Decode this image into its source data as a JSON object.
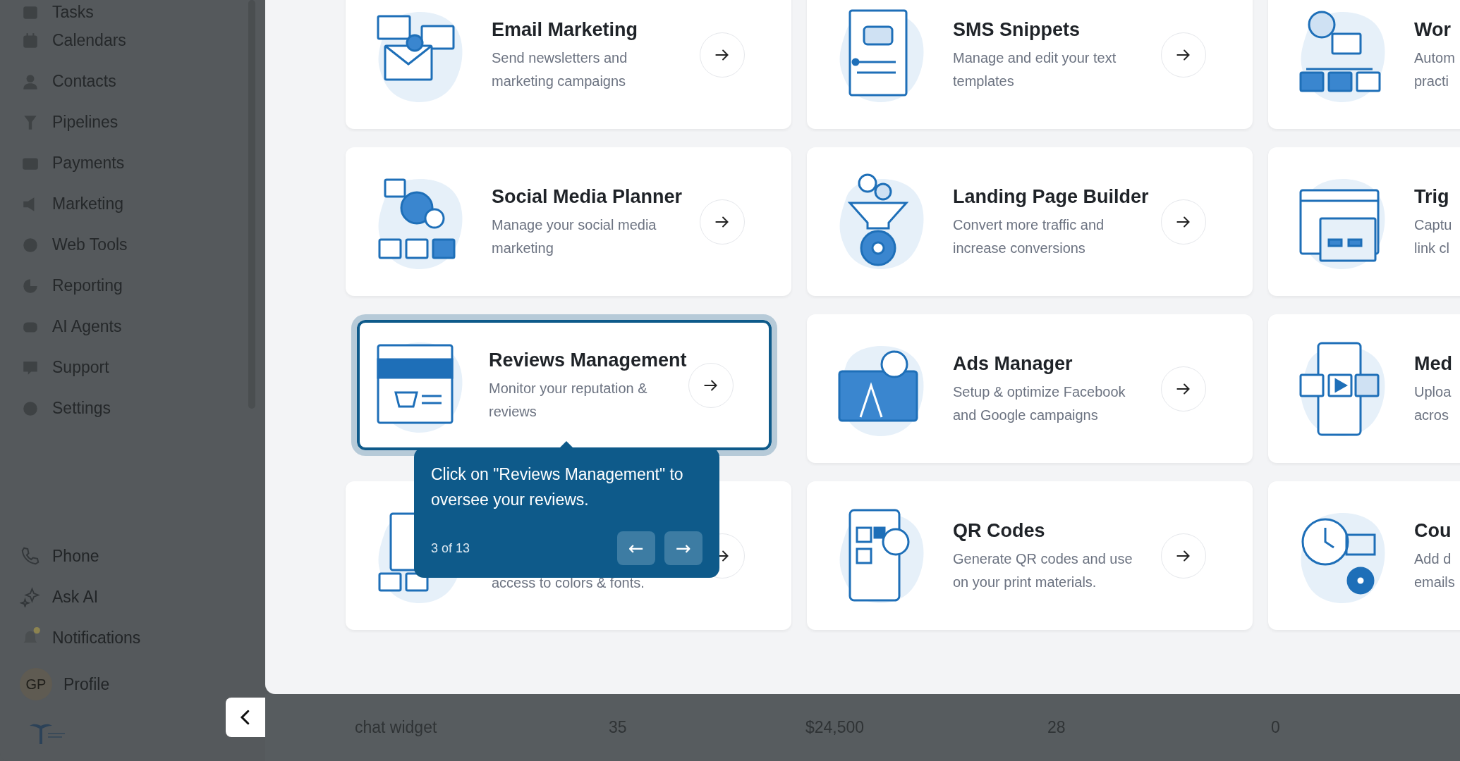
{
  "sidebar": {
    "items": [
      {
        "label": "Tasks"
      },
      {
        "label": "Calendars"
      },
      {
        "label": "Contacts"
      },
      {
        "label": "Pipelines"
      },
      {
        "label": "Payments"
      },
      {
        "label": "Marketing"
      },
      {
        "label": "Web Tools"
      },
      {
        "label": "Reporting"
      },
      {
        "label": "AI Agents"
      },
      {
        "label": "Support"
      },
      {
        "label": "Settings"
      }
    ],
    "bottom_items": [
      {
        "label": "Phone",
        "kind": "phone"
      },
      {
        "label": "Ask AI",
        "kind": "ai"
      },
      {
        "label": "Notifications",
        "kind": "bell",
        "badge": true
      },
      {
        "label": "Profile",
        "kind": "avatar",
        "initials": "GP"
      }
    ]
  },
  "cards": [
    {
      "title": "Email Marketing",
      "description": [
        "Send newsletters and",
        "marketing campaigns"
      ],
      "arrow": true,
      "selected": false
    },
    {
      "title": "Social Media Planner",
      "description": [
        "Manage your social media",
        "marketing"
      ],
      "arrow": true,
      "selected": false
    },
    {
      "title": "Reviews Management",
      "description": [
        "Monitor your reputation &",
        "reviews"
      ],
      "arrow": true,
      "selected": true
    },
    {
      "description": [
        "access to colors & fonts."
      ],
      "arrow": true,
      "selected": false
    },
    {
      "title": "SMS Snippets",
      "description": [
        "Manage and edit your text",
        "templates"
      ],
      "arrow": true,
      "selected": false
    },
    {
      "title": "Landing Page Builder",
      "description": [
        "Convert more traffic and",
        "increase conversions"
      ],
      "arrow": true,
      "selected": false
    },
    {
      "title": "Ads Manager",
      "description": [
        "Setup & optimize Facebook",
        "and Google campaigns"
      ],
      "arrow": true,
      "selected": false
    },
    {
      "title": "QR Codes",
      "description": [
        "Generate QR codes and use",
        "on your print materials."
      ],
      "arrow": true,
      "selected": false
    },
    {
      "title": "Wor",
      "description": [
        "Autom",
        "practi"
      ],
      "arrow": false,
      "selected": false
    },
    {
      "title": "Trig",
      "description": [
        "Captu",
        "link cl"
      ],
      "arrow": false,
      "selected": false
    },
    {
      "title": "Med",
      "description": [
        "Uploa",
        "acros"
      ],
      "arrow": false,
      "selected": false
    },
    {
      "title": "Cou",
      "description": [
        "Add d",
        "emails"
      ],
      "arrow": false,
      "selected": false
    }
  ],
  "tour_tooltip": {
    "text": "Click on \"Reviews Management\" to oversee your reviews.",
    "step": "3 of 13",
    "prev_symbol": "←",
    "next_symbol": "→"
  },
  "table_row": {
    "cells": [
      "chat widget",
      "35",
      "$24,500",
      "28",
      "0"
    ]
  }
}
